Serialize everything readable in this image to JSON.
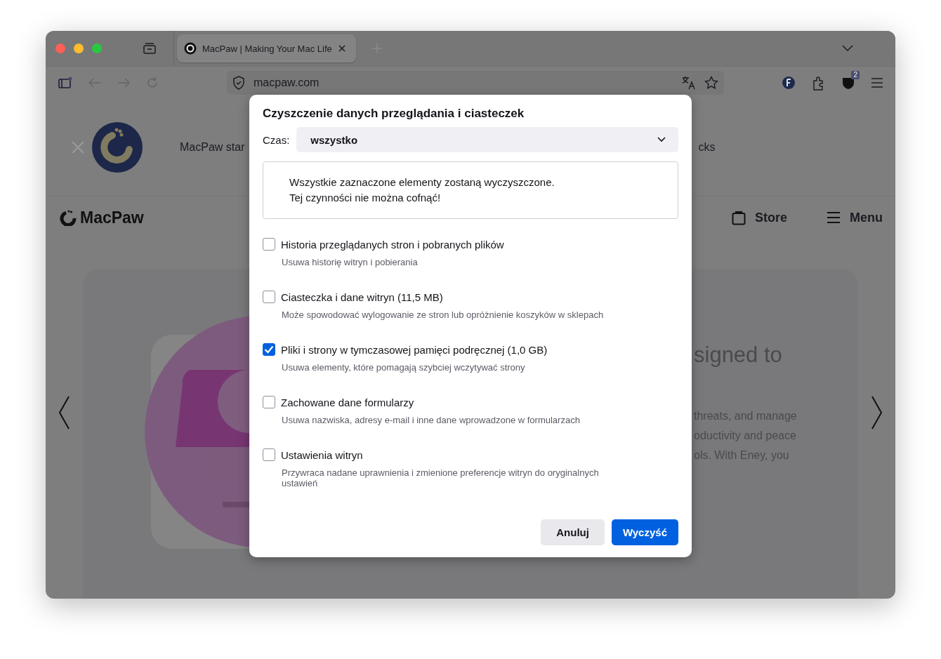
{
  "tabs": [
    {
      "title": "MacPaw | Making Your Mac Life",
      "selected": true
    }
  ],
  "address_bar": {
    "url": "macpaw.com"
  },
  "extension_badge": "2",
  "page": {
    "banner": {
      "text": "MacPaw star",
      "text_2": "cks"
    },
    "nav": {
      "logo": "MacPaw",
      "store": "Store",
      "menu": "Menu"
    },
    "hero": {
      "heading": "signed to",
      "lines": [
        "threats, and manage",
        "oductivity and peace",
        "ols. With Eney, you"
      ]
    }
  },
  "dialog": {
    "title": "Czyszczenie danych przeglądania i ciasteczek",
    "time_label": "Czas:",
    "time_value": "wszystko",
    "warning": [
      "Wszystkie zaznaczone elementy zostaną wyczyszczone.",
      "Tej czynności nie można cofnąć!"
    ],
    "options": [
      {
        "label": "Historia przeglądanych stron i pobranych plików",
        "description": "Usuwa historię witryn i pobierania",
        "checked": false
      },
      {
        "label": "Ciasteczka i dane witryn (11,5 MB)",
        "description": "Może spowodować wylogowanie ze stron lub opróżnienie koszyków w sklepach",
        "checked": false
      },
      {
        "label": "Pliki i strony w tymczasowej pamięci podręcznej (1,0 GB)",
        "description": "Usuwa elementy, które pomagają szybciej wczytywać strony",
        "checked": true
      },
      {
        "label": "Zachowane dane formularzy",
        "description": "Usuwa nazwiska, adresy e-mail i inne dane wprowadzone w formularzach",
        "checked": false
      },
      {
        "label": "Ustawienia witryn",
        "description": "Przywraca nadane uprawnienia i zmienione preferencje witryn do oryginalnych ustawień",
        "checked": false
      }
    ],
    "buttons": [
      {
        "label": "Anuluj",
        "kind": "secondary"
      },
      {
        "label": "Wyczyść",
        "kind": "primary"
      }
    ]
  }
}
